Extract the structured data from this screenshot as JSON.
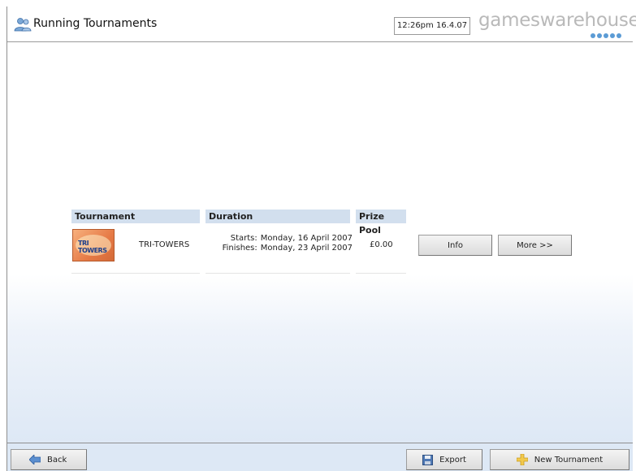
{
  "header": {
    "title": "Running Tournaments",
    "title_icon": "users-icon",
    "clock": "12:26pm 16.4.07",
    "brand": "gameswarehouse"
  },
  "table": {
    "columns": [
      "Tournament",
      "Duration",
      "Prize Pool"
    ],
    "rows": [
      {
        "thumbnail_text": "TRI TOWERS",
        "name": "TRI-TOWERS",
        "starts_label": "Starts:",
        "starts": "Monday, 16 April 2007",
        "finishes_label": "Finishes:",
        "finishes": "Monday, 23 April 2007",
        "prize": "£0.00",
        "info_label": "Info",
        "more_label": "More >>"
      }
    ]
  },
  "footer": {
    "back_label": "Back",
    "export_label": "Export",
    "new_tournament_label": "New Tournament"
  },
  "colors": {
    "accent": "#d2dfee",
    "gradient_bottom": "#dde8f5",
    "logo_grey": "#b9b9b9",
    "logo_dots": "#5b9bd5"
  }
}
